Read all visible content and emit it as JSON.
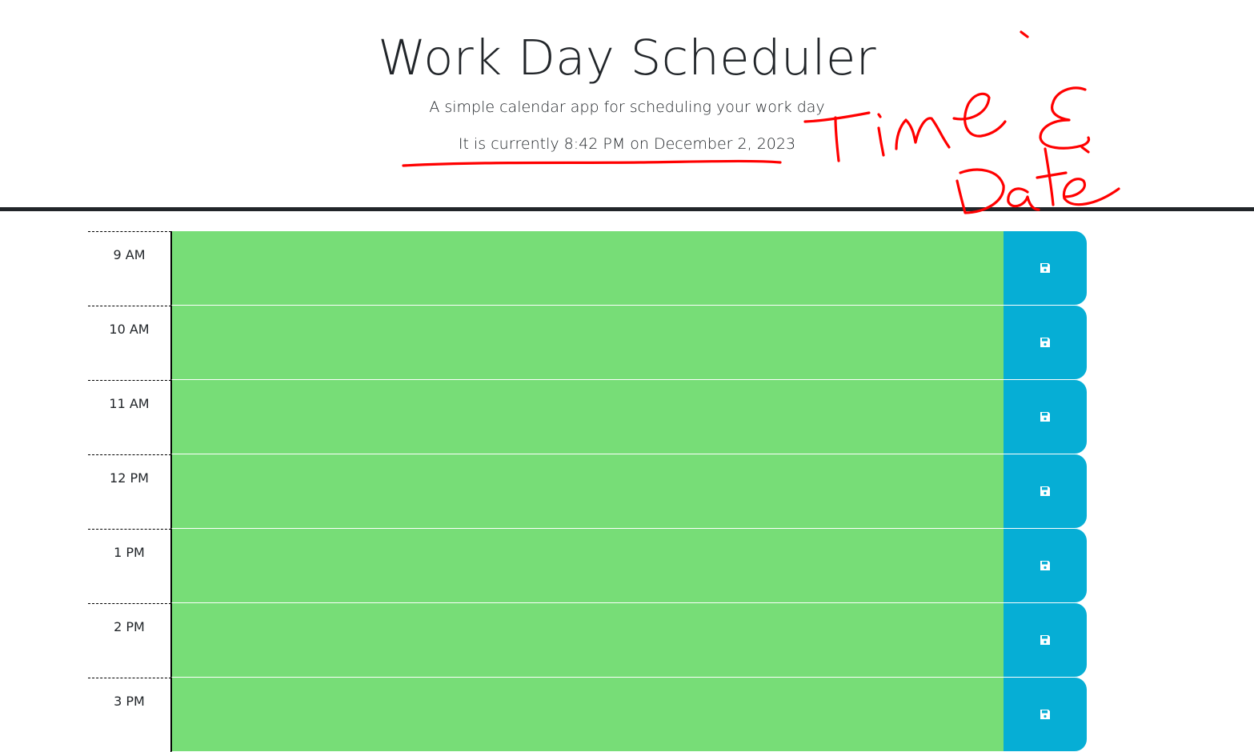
{
  "header": {
    "title": "Work Day Scheduler",
    "subtitle": "A simple calendar app for scheduling your work day",
    "current_time": "It is currently 8:42 PM on December 2, 2023"
  },
  "annotation": {
    "text_line1": "Time &",
    "text_line2": "Date",
    "color": "#ff0000"
  },
  "schedule": {
    "block_color": "#77dd77",
    "save_button_color": "#06aed5",
    "save_icon": "floppy-disk-icon",
    "blocks": [
      {
        "hour": "9 AM",
        "text": ""
      },
      {
        "hour": "10 AM",
        "text": ""
      },
      {
        "hour": "11 AM",
        "text": ""
      },
      {
        "hour": "12 PM",
        "text": ""
      },
      {
        "hour": "1 PM",
        "text": ""
      },
      {
        "hour": "2 PM",
        "text": ""
      },
      {
        "hour": "3 PM",
        "text": ""
      }
    ]
  }
}
